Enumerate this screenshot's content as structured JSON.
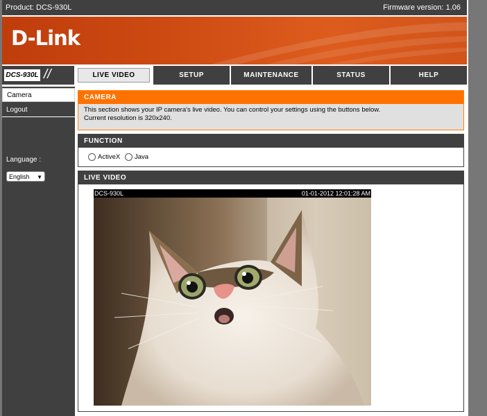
{
  "topbar": {
    "product": "Product: DCS-930L",
    "firmware": "Firmware version: 1.06"
  },
  "header": {
    "logo": "D-Link"
  },
  "model": {
    "tag": "DCS-930L"
  },
  "nav": [
    {
      "label": "LIVE VIDEO",
      "active": true
    },
    {
      "label": "SETUP"
    },
    {
      "label": "MAINTENANCE"
    },
    {
      "label": "STATUS"
    },
    {
      "label": "HELP"
    }
  ],
  "sidebar": {
    "camera": "Camera",
    "logout": "Logout",
    "language_label": "Language :",
    "language_value": "English"
  },
  "camera_section": {
    "title": "CAMERA",
    "line1": "This section shows your IP camera's live video. You can control your settings using the buttons below.",
    "line2": "Current resolution is 320x240."
  },
  "function_section": {
    "title": "FUNCTION",
    "option_activex": "ActiveX",
    "option_java": "Java"
  },
  "live_section": {
    "title": "LIVE VIDEO",
    "overlay_left": "DCS-930L",
    "overlay_right": "01-01-2012 12:01:28 AM"
  },
  "colors": {
    "accent": "#ff7200",
    "dark": "#404040"
  }
}
